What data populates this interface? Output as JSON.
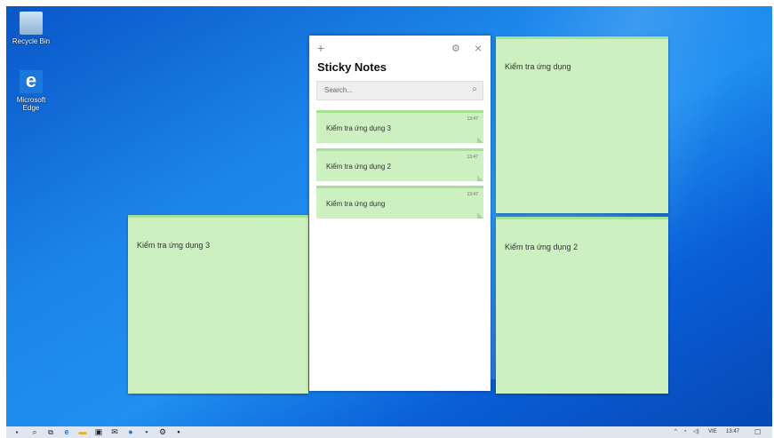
{
  "desktop": {
    "icons": [
      {
        "label": "Recycle Bin"
      },
      {
        "label": "Microsoft Edge"
      }
    ]
  },
  "sticky_notes": {
    "title": "Sticky Notes",
    "new_icon": "+",
    "settings_icon": "⚙",
    "close_icon": "×",
    "search_placeholder": "Search...",
    "search_icon": "⌕",
    "list": [
      {
        "text": "Kiểm tra ứng dụng 3",
        "time": "13:47"
      },
      {
        "text": "Kiểm tra ứng dụng 2",
        "time": "13:47"
      },
      {
        "text": "Kiểm tra ứng dụng",
        "time": "13:47"
      }
    ]
  },
  "notes": {
    "left": "Kiểm tra ứng dụng 3",
    "right_top": "Kiểm tra ứng dụng",
    "right_bottom": "Kiểm tra ứng dụng 2"
  },
  "taskbar": {
    "lang": "VIE",
    "time": "13:47"
  },
  "colors": {
    "note_bg": "#cdf0c1",
    "note_border": "#a8e196",
    "desktop_blue": "#1c86ea"
  }
}
